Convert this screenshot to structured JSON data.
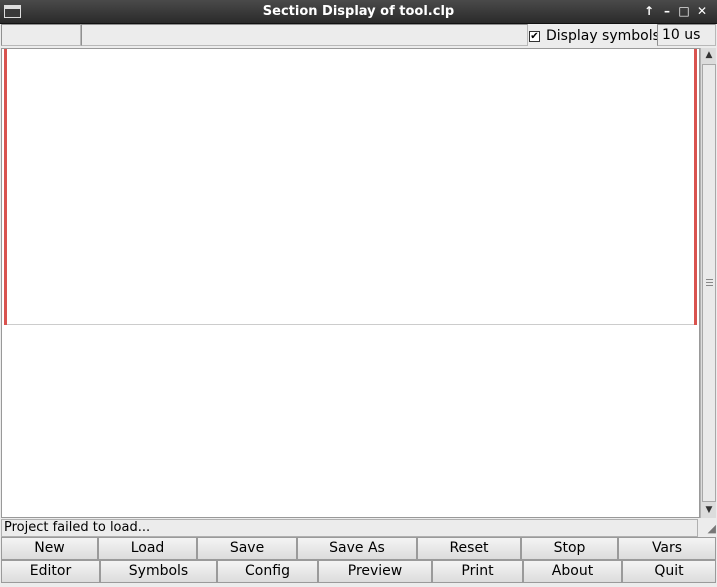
{
  "window": {
    "title": "Section Display of tool.clp"
  },
  "toolbar": {
    "field1_value": "",
    "field2_value": "",
    "display_symbols_label": "Display symbols",
    "display_symbols_checked": true,
    "time_value": "10 us"
  },
  "status": {
    "message": "Project failed to load..."
  },
  "buttons_row1": [
    {
      "label": "New"
    },
    {
      "label": "Load"
    },
    {
      "label": "Save"
    },
    {
      "label": "Save As"
    },
    {
      "label": "Reset"
    },
    {
      "label": "Stop"
    },
    {
      "label": "Vars"
    }
  ],
  "buttons_row2": [
    {
      "label": "Editor"
    },
    {
      "label": "Symbols"
    },
    {
      "label": "Config"
    },
    {
      "label": "Preview"
    },
    {
      "label": "Print"
    },
    {
      "label": "About"
    },
    {
      "label": "Quit"
    }
  ],
  "colors": {
    "section_marker": "#d9534f",
    "titlebar": "#3a3a3a"
  }
}
